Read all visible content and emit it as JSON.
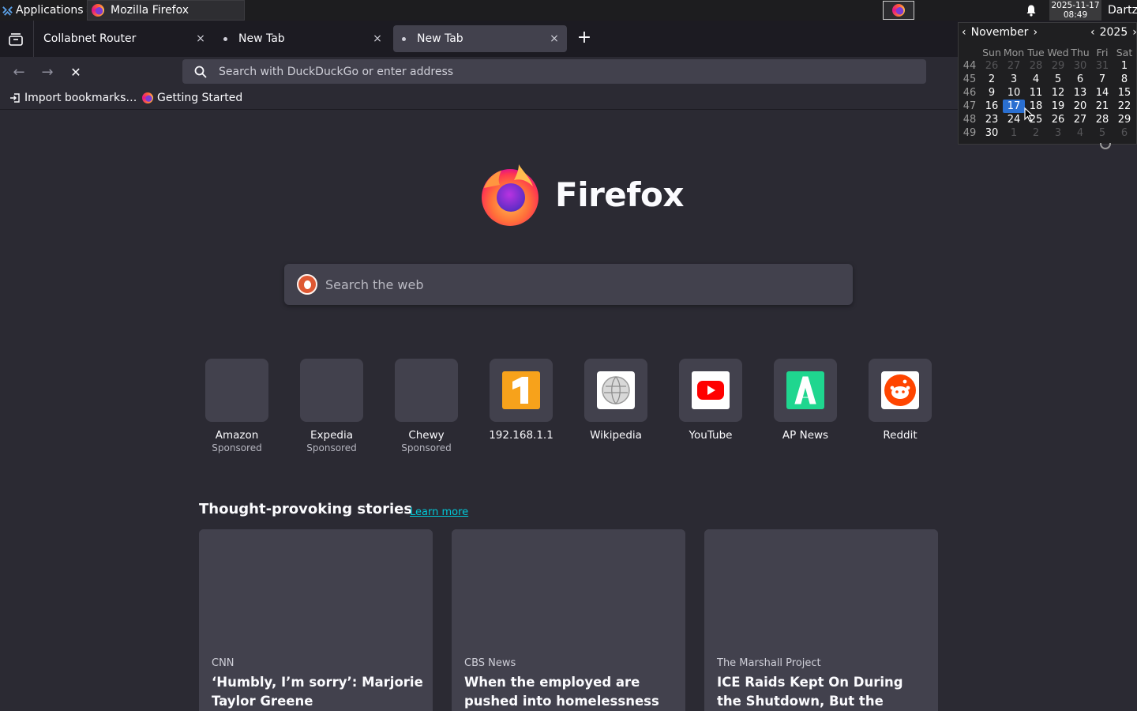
{
  "panel": {
    "apps_label": "Applications",
    "apps_glyph": "⠿",
    "task_label": "Mozilla Firefox",
    "clock_date": "2025-11-17",
    "clock_time": "08:49",
    "user": "Dartz"
  },
  "tabs": [
    {
      "label": "Collabnet Router",
      "close": "×",
      "active": false
    },
    {
      "label": "New Tab",
      "close": "×",
      "active": false
    },
    {
      "label": "New Tab",
      "close": "×",
      "active": true
    }
  ],
  "newtab_plus": "+",
  "nav": {
    "back": "←",
    "forward": "→",
    "stop": "✕",
    "url_placeholder": "Search with DuckDuckGo or enter address"
  },
  "bookmarks": {
    "import": "Import bookmarks…",
    "getting_started": "Getting Started"
  },
  "newtab": {
    "brand": "Firefox",
    "search_placeholder": "Search the web",
    "tiles": [
      {
        "name": "Amazon",
        "sponsored": "Sponsored"
      },
      {
        "name": "Expedia",
        "sponsored": "Sponsored"
      },
      {
        "name": "Chewy",
        "sponsored": "Sponsored"
      },
      {
        "name": "192.168.1.1",
        "sponsored": ""
      },
      {
        "name": "Wikipedia",
        "sponsored": ""
      },
      {
        "name": "YouTube",
        "sponsored": ""
      },
      {
        "name": "AP News",
        "sponsored": ""
      },
      {
        "name": "Reddit",
        "sponsored": ""
      }
    ],
    "stories_heading": "Thought-provoking stories",
    "learn_more": "Learn more",
    "stories": [
      {
        "source": "CNN",
        "title": "‘Humbly, I’m sorry’: Marjorie Taylor Greene"
      },
      {
        "source": "CBS News",
        "title": "When the employed are pushed into homelessness"
      },
      {
        "source": "The Marshall Project",
        "title": "ICE Raids Kept On During the Shutdown, But the"
      }
    ]
  },
  "calendar": {
    "month": "November",
    "year": "2025",
    "prev": "‹",
    "next": "›",
    "weekdays": [
      "Sun",
      "Mon",
      "Tue",
      "Wed",
      "Thu",
      "Fri",
      "Sat"
    ],
    "weeks": [
      {
        "wk": "44",
        "days": [
          "26",
          "27",
          "28",
          "29",
          "30",
          "31",
          "1"
        ]
      },
      {
        "wk": "45",
        "days": [
          "2",
          "3",
          "4",
          "5",
          "6",
          "7",
          "8"
        ]
      },
      {
        "wk": "46",
        "days": [
          "9",
          "10",
          "11",
          "12",
          "13",
          "14",
          "15"
        ]
      },
      {
        "wk": "47",
        "days": [
          "16",
          "17",
          "18",
          "19",
          "20",
          "21",
          "22"
        ]
      },
      {
        "wk": "48",
        "days": [
          "23",
          "24",
          "25",
          "26",
          "27",
          "28",
          "29"
        ]
      },
      {
        "wk": "49",
        "days": [
          "30",
          "1",
          "2",
          "3",
          "4",
          "5",
          "6"
        ]
      }
    ],
    "today": "17",
    "colors": {
      "today": "#2a6fd1",
      "dim": "#555558"
    }
  },
  "colors": {
    "accent_link": "#00c8d7",
    "background": "#2b2a33",
    "tile": "#42414d"
  }
}
